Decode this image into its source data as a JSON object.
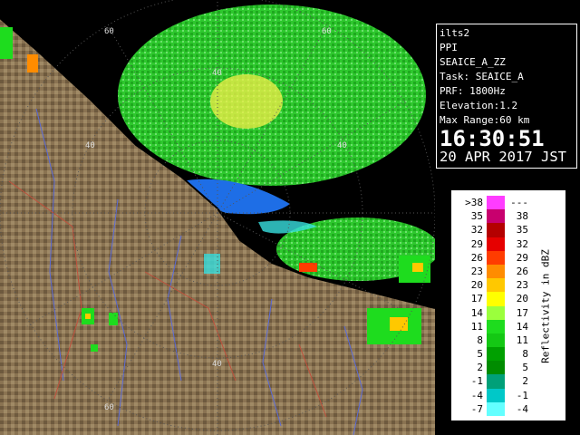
{
  "info": {
    "station": "ilts2",
    "scan_type": "PPI",
    "product": "SEAICE_A_ZZ",
    "task": "Task: SEAICE_A",
    "prf": "PRF: 1800Hz",
    "elevation": "Elevation:1.2",
    "max_range": "Max Range:60 km",
    "time": "16:30:51",
    "date": "20 APR 2017 JST"
  },
  "radar": {
    "range_labels": [
      "60",
      "40",
      "40",
      "60",
      "40",
      "40",
      "60"
    ],
    "colors": {
      "land": "#8a7352",
      "water": "#1e6ee6",
      "echo_green": "#2ec82e",
      "echo_yellow": "#f5f04a",
      "echo_red": "#e03020",
      "cyan": "#38e0e0"
    }
  },
  "legend": {
    "title": "Reflectivity in dBZ",
    "rows": [
      {
        "lo": ">38",
        "hi": "---",
        "color": "#ff3cff"
      },
      {
        "lo": "35",
        "hi": "38",
        "color": "#c8006e"
      },
      {
        "lo": "32",
        "hi": "35",
        "color": "#b40000"
      },
      {
        "lo": "29",
        "hi": "32",
        "color": "#e60000"
      },
      {
        "lo": "26",
        "hi": "29",
        "color": "#ff3c00"
      },
      {
        "lo": "23",
        "hi": "26",
        "color": "#ff8c00"
      },
      {
        "lo": "20",
        "hi": "23",
        "color": "#ffc800"
      },
      {
        "lo": "17",
        "hi": "20",
        "color": "#ffff00"
      },
      {
        "lo": "14",
        "hi": "17",
        "color": "#9bff3c"
      },
      {
        "lo": "11",
        "hi": "14",
        "color": "#1edc1e"
      },
      {
        "lo": "8",
        "hi": "11",
        "color": "#14c814"
      },
      {
        "lo": "5",
        "hi": "8",
        "color": "#00a000"
      },
      {
        "lo": "2",
        "hi": "5",
        "color": "#008c00"
      },
      {
        "lo": "-1",
        "hi": "2",
        "color": "#00a078"
      },
      {
        "lo": "-4",
        "hi": "-1",
        "color": "#00c8c8"
      },
      {
        "lo": "-7",
        "hi": "-4",
        "color": "#64ffff"
      }
    ]
  }
}
